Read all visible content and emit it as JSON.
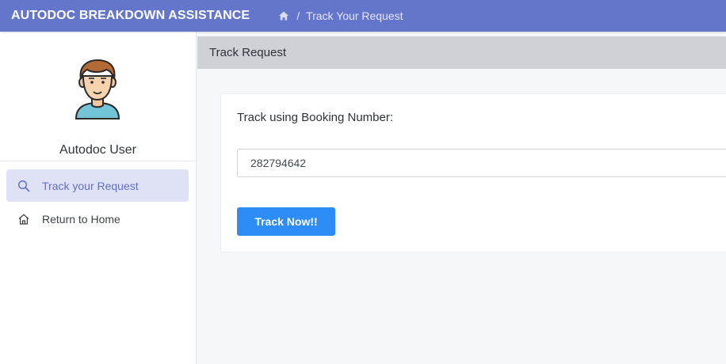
{
  "app": {
    "brand": "AUTODOC BREAKDOWN ASSISTANCE"
  },
  "breadcrumb": {
    "home_icon": "home-icon",
    "separator": "/",
    "current": "Track Your Request"
  },
  "sidebar": {
    "user_name": "Autodoc User",
    "items": [
      {
        "label": "Track your Request",
        "icon": "search-icon",
        "active": true
      },
      {
        "label": "Return to Home",
        "icon": "home-icon",
        "active": false
      }
    ]
  },
  "main": {
    "section_title": "Track Request",
    "form": {
      "label": "Track using Booking Number:",
      "booking_number": "282794642",
      "submit_label": "Track Now!!"
    }
  },
  "colors": {
    "topbar": "#6475cc",
    "active_nav_bg": "#dfe2f5",
    "active_nav_text": "#6270c4",
    "primary_button": "#2e8cf6",
    "section_header": "#ced2d7"
  }
}
